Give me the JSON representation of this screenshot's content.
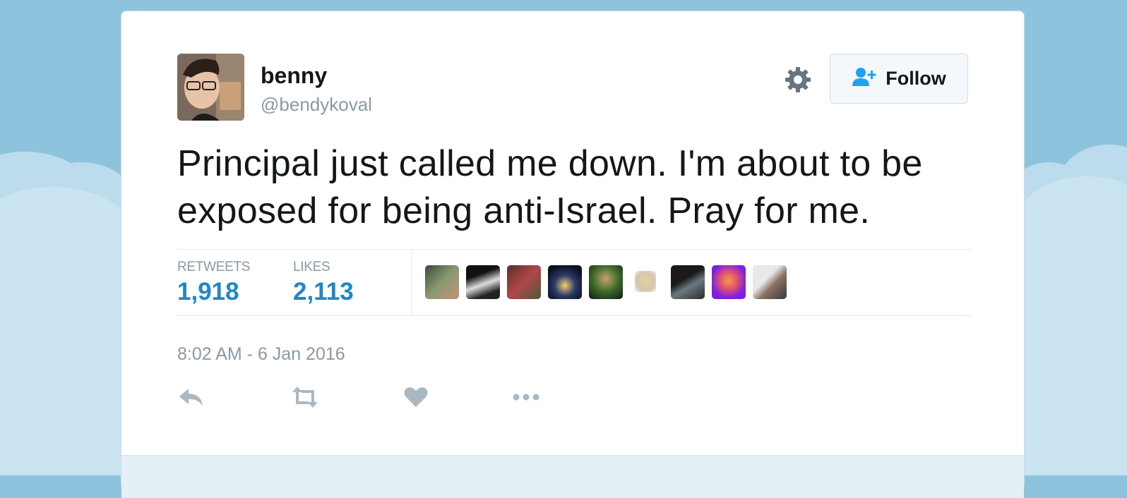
{
  "user": {
    "display_name": "benny",
    "handle": "@bendykoval"
  },
  "header": {
    "follow_label": "Follow",
    "settings_icon": "gear-icon",
    "follow_icon": "add-user-icon"
  },
  "tweet": {
    "text": "Principal just called me down. I'm about to be exposed for being anti-Israel. Pray for me.",
    "timestamp": "8:02 AM - 6 Jan 2016"
  },
  "stats": {
    "retweets_label": "RETWEETS",
    "retweets_value": "1,918",
    "likes_label": "LIKES",
    "likes_value": "2,113"
  },
  "likers_count_shown": 9,
  "actions": [
    "reply-icon",
    "retweet-icon",
    "like-icon",
    "more-icon"
  ],
  "colors": {
    "background": "#8ec3de",
    "card": "#ffffff",
    "text": "#14171a",
    "muted": "#8899a6",
    "stat_value": "#1f87c6",
    "follow_icon": "#1da1f2",
    "action_icon": "#aab8c2"
  }
}
